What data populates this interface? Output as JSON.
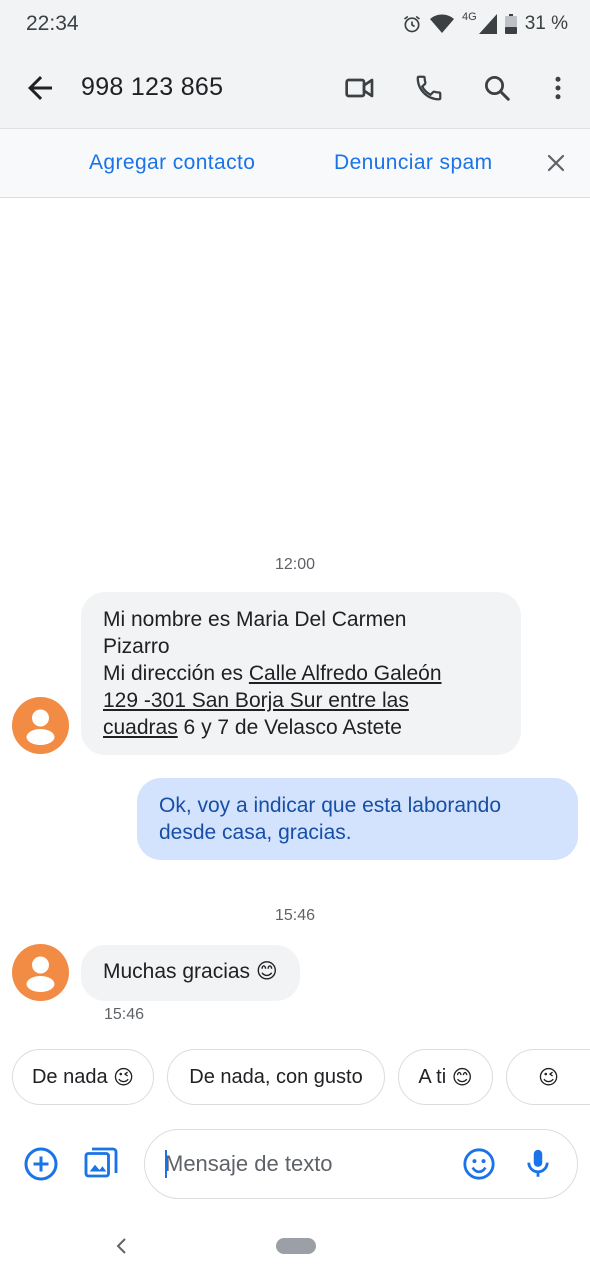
{
  "status_bar": {
    "time": "22:34",
    "network_label": "4G",
    "battery": "31 %",
    "icons": [
      "alarm-icon",
      "wifi-icon",
      "signal-icon",
      "battery-icon"
    ]
  },
  "app_bar": {
    "title": "998 123 865",
    "icons": [
      "back-arrow-icon",
      "video-call-icon",
      "phone-icon",
      "search-icon",
      "more-vert-icon"
    ]
  },
  "banner": {
    "add_contact": "Agregar contacto",
    "report_spam": "Denunciar spam",
    "close_icon": "close-icon"
  },
  "conversation": {
    "timestamp_1": "12:00",
    "message_1": {
      "line1": "Mi nombre es Maria Del Carmen",
      "line2": "Pizarro",
      "line3_prefix": "Mi dirección es ",
      "line3_link": "Calle Alfredo Galeón",
      "line4_link": "129 -301 San Borja Sur entre las",
      "line5_link": "cuadras",
      "line5_suffix": " 6 y 7 de Velasco Astete"
    },
    "message_2": {
      "line1": "Ok, voy a indicar que esta laborando",
      "line2": "desde casa, gracias."
    },
    "timestamp_2": "15:46",
    "message_3": {
      "text": "Muchas gracias",
      "emoji": "😊"
    },
    "message_3_time": "15:46"
  },
  "suggestions": {
    "chip1": {
      "text": "De nada",
      "emoji": "😉"
    },
    "chip2": {
      "text": "De nada, con gusto"
    },
    "chip3": {
      "text": "A ti",
      "emoji": "😊"
    },
    "chip4": {
      "emoji": "😉"
    }
  },
  "compose": {
    "placeholder": "Mensaje de texto",
    "icons": [
      "add-circle-icon",
      "gallery-icon",
      "emoji-icon",
      "microphone-icon"
    ]
  },
  "colors": {
    "accent": "#1a73e8",
    "avatar": "#f28b44",
    "incoming_bubble": "#f1f3f4",
    "outgoing_bubble": "#d3e3fd",
    "outgoing_text": "#174ea6",
    "header_bg": "#f1f3f4"
  }
}
